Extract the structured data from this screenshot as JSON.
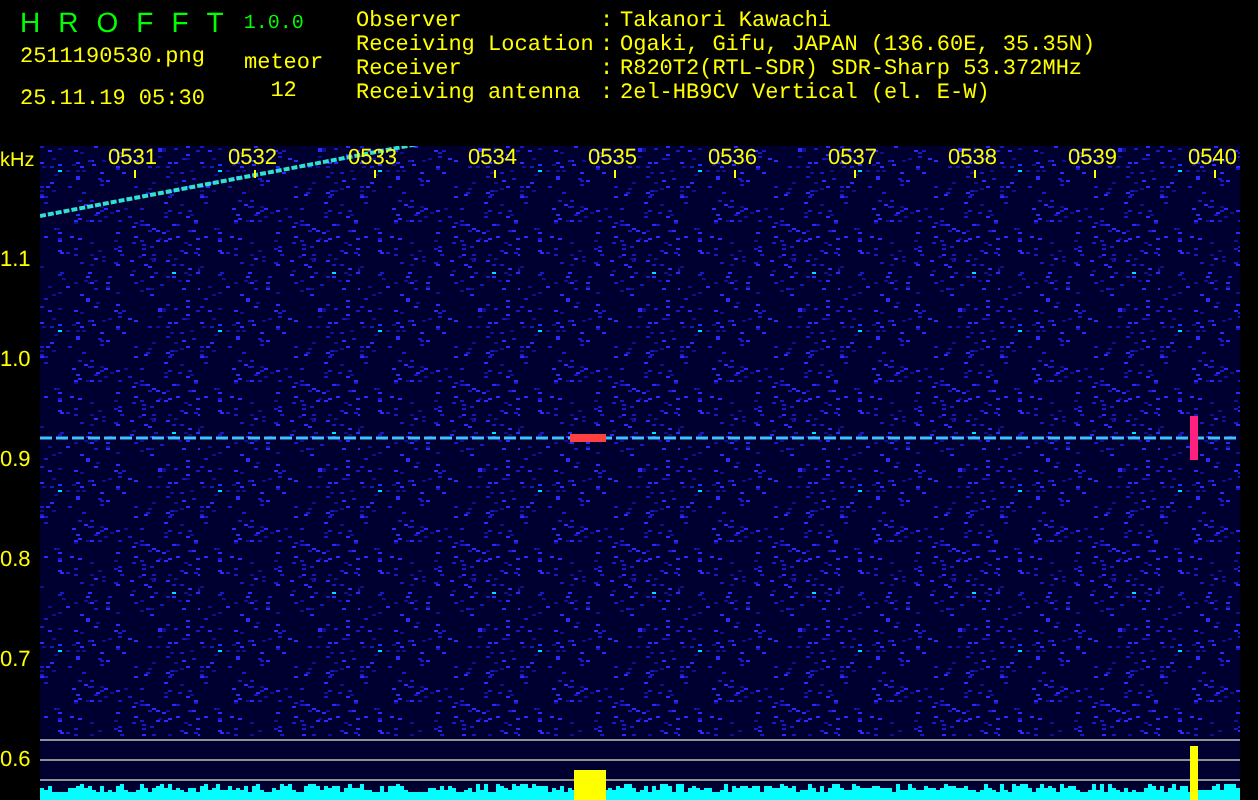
{
  "app": {
    "letters": [
      "H",
      "R",
      "O",
      "F",
      "F",
      "T"
    ],
    "version": "1.0.0"
  },
  "file": "2511190530.png",
  "timestamp": "25.11.19 05:30",
  "counter": {
    "label": "meteor",
    "value": "12"
  },
  "info": [
    {
      "label": "Observer",
      "separator": ":",
      "value": "Takanori Kawachi"
    },
    {
      "label": "Receiving Location",
      "separator": ":",
      "value": "Ogaki, Gifu, JAPAN (136.60E, 35.35N)"
    },
    {
      "label": "Receiver",
      "separator": ":",
      "value": "R820T2(RTL-SDR) SDR-Sharp 53.372MHz"
    },
    {
      "label": "Receiving antenna",
      "separator": ":",
      "value": "2el-HB9CV Vertical (el. E-W)"
    }
  ],
  "spectrogram": {
    "unit": "kHz",
    "time_labels": [
      "0531",
      "0532",
      "0533",
      "0534",
      "0535",
      "0536",
      "0537",
      "0538",
      "0539",
      "0540"
    ],
    "freq_labels": [
      "1.1",
      "1.0",
      "0.9",
      "0.8",
      "0.7",
      "0.6"
    ]
  }
}
